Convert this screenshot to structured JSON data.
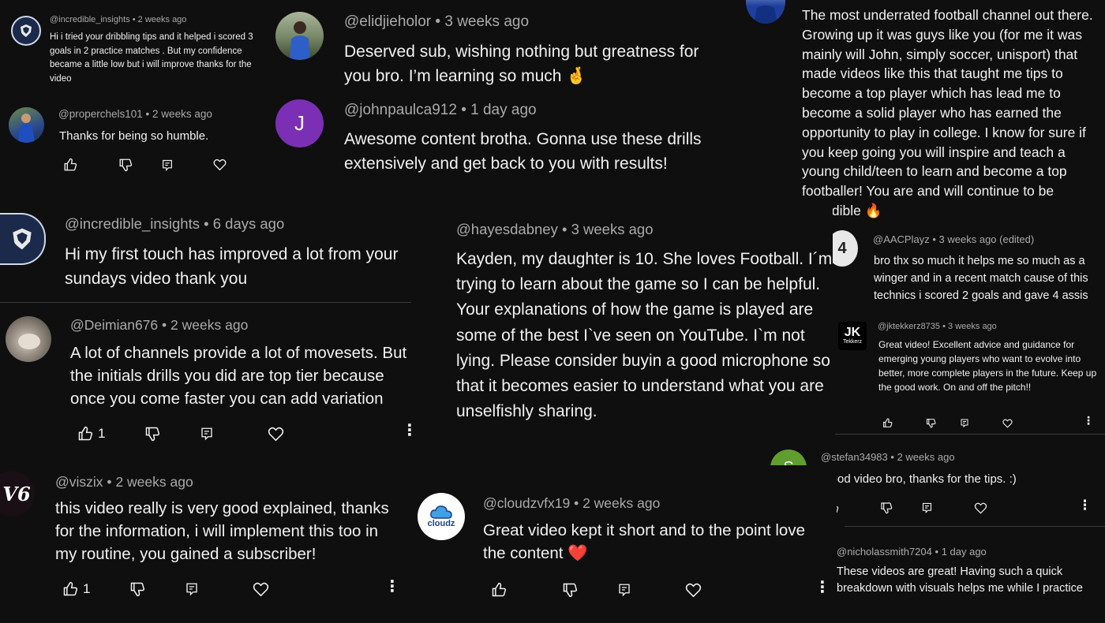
{
  "comments": [
    {
      "id": "c1",
      "handle": "@incredible_insights",
      "time": "2 weeks ago",
      "text": "Hi i tried your dribbling tips and it helped i scored 3 goals in 2 practice matches . But my confidence became a little low but i will improve thanks for the video"
    },
    {
      "id": "c2",
      "handle": "@properchels101",
      "time": "2 weeks ago",
      "text": "Thanks for being so humble."
    },
    {
      "id": "c3",
      "handle": "@elidjieholor",
      "time": "3 weeks ago",
      "text": "Deserved sub, wishing nothing but greatness for you bro. I’m learning so much 🤞"
    },
    {
      "id": "c4",
      "handle": "@johnpaulca912",
      "time": "1 day ago",
      "avatar_letter": "J",
      "text": "Awesome content brotha. Gonna use these drills extensively and get back to you with results!"
    },
    {
      "id": "c5",
      "text": "The most underrated football channel out there. Growing up it was guys like you (for me it was mainly will John, simply soccer, unisport) that made videos like this that taught me tips to become a top player which has lead me to become a solid player who has earned the opportunity to play in college. I know for sure if you keep going you will inspire and teach a young child/teen to learn and become a top footballer! You are and will continue to be incredible 🔥"
    },
    {
      "id": "c6",
      "handle": "@incredible_insights",
      "time": "6 days ago",
      "text": "Hi my first touch has improved a lot from your sundays video thank you"
    },
    {
      "id": "c7",
      "handle": "@hayesdabney",
      "time": "3 weeks ago",
      "text": "Kayden, my daughter is 10. She loves Football. I´m trying to learn about the game so I can be helpful. Your explanations of how the game is played are some of the best I`ve seen on YouTube. I`m not lying. Please consider buyin a good microphone so that it becomes easier to understand what you are unselfishly sharing."
    },
    {
      "id": "c8",
      "handle": "@AACPlayz",
      "time": "3 weeks ago (edited)",
      "text": "bro thx so much it helps me so much as a winger and in a recent match cause of this technics i scored 2 goals and gave 4 assis"
    },
    {
      "id": "c9",
      "handle": "@jktekkerz8735",
      "time": "3 weeks ago",
      "avatar_text": "JK",
      "avatar_sub": "Tekkerz",
      "text": "Great video! Excellent advice and guidance for emerging young players who want to evolve into better, more complete players in the future. Keep up the good work. On and off the pitch!!"
    },
    {
      "id": "c10",
      "handle": "@Deimian676",
      "time": "2 weeks ago",
      "likes": "1",
      "text": "A lot of channels provide a lot of movesets. But the initials drills you did are top tier because once you come faster you can add variation"
    },
    {
      "id": "c11",
      "handle": "@stefan34983",
      "time": "2 weeks ago",
      "avatar_letter": "S",
      "text": "Good video bro, thanks for the tips. :)"
    },
    {
      "id": "c12",
      "handle": "@viszix",
      "time": "2 weeks ago",
      "likes": "1",
      "avatar_text": "V6",
      "text": "this video really is very good explained, thanks for the information, i will implement this too in my routine, you gained a subscriber!"
    },
    {
      "id": "c13",
      "handle": "@cloudzvfx19",
      "time": "2 weeks ago",
      "avatar_text": "cloudz",
      "text": "Great video kept it short and to the point love the content ❤️"
    },
    {
      "id": "c14",
      "handle": "@nicholassmith7204",
      "time": "1 day ago",
      "text": "These videos are great! Having such a quick breakdown with visuals helps me while I practice"
    }
  ],
  "separator": "•",
  "more_glyph": "⋮",
  "colors": {
    "bg": "#0f0f0f",
    "meta": "#aaaaaa",
    "text": "#f1f1f1",
    "purple": "#7b2fb5",
    "green": "#5f9e2f"
  }
}
